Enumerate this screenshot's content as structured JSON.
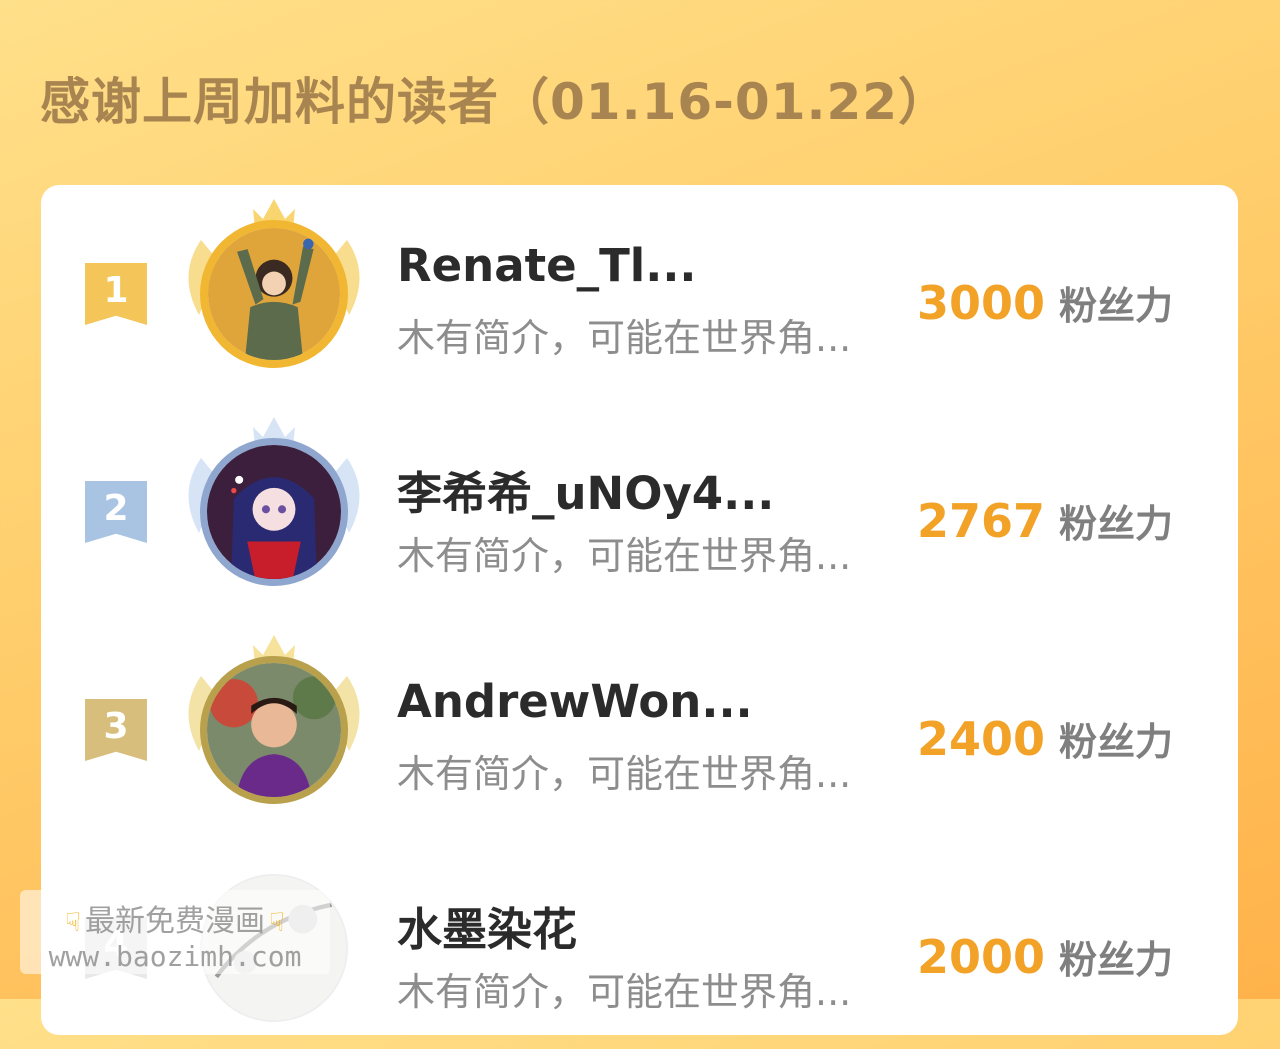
{
  "header": {
    "title": "感谢上周加料的读者（01.16-01.22）"
  },
  "leaderboard": {
    "unit_label": "粉丝力",
    "entries": [
      {
        "rank": "1",
        "name": "Renate_Tl...",
        "bio": "木有简介，可能在世界角...",
        "score": "3000",
        "medal": "gold",
        "rank_color": "#f4c65a"
      },
      {
        "rank": "2",
        "name": "李希希_uNOy4...",
        "bio": "木有简介，可能在世界角...",
        "score": "2767",
        "medal": "silver",
        "rank_color": "#a9c3e3"
      },
      {
        "rank": "3",
        "name": "AndrewWon...",
        "bio": "木有简介，可能在世界角...",
        "score": "2400",
        "medal": "bronze",
        "rank_color": "#d8be7c"
      },
      {
        "rank": "4",
        "name": "水墨染花",
        "bio": "木有简介，可能在世界角...",
        "score": "2000",
        "medal": "none",
        "rank_color": "#e8e8e8"
      }
    ]
  },
  "watermark": {
    "line1": "最新免费漫画",
    "line2": "www.baozimh.com",
    "icon": "pointing-down-hand-icon"
  },
  "colors": {
    "score": "#f2a227",
    "title": "#a88450",
    "gold_ring": "#f1b733",
    "silver_ring": "#8fa6cf",
    "bronze_ring": "#b8a04c"
  }
}
